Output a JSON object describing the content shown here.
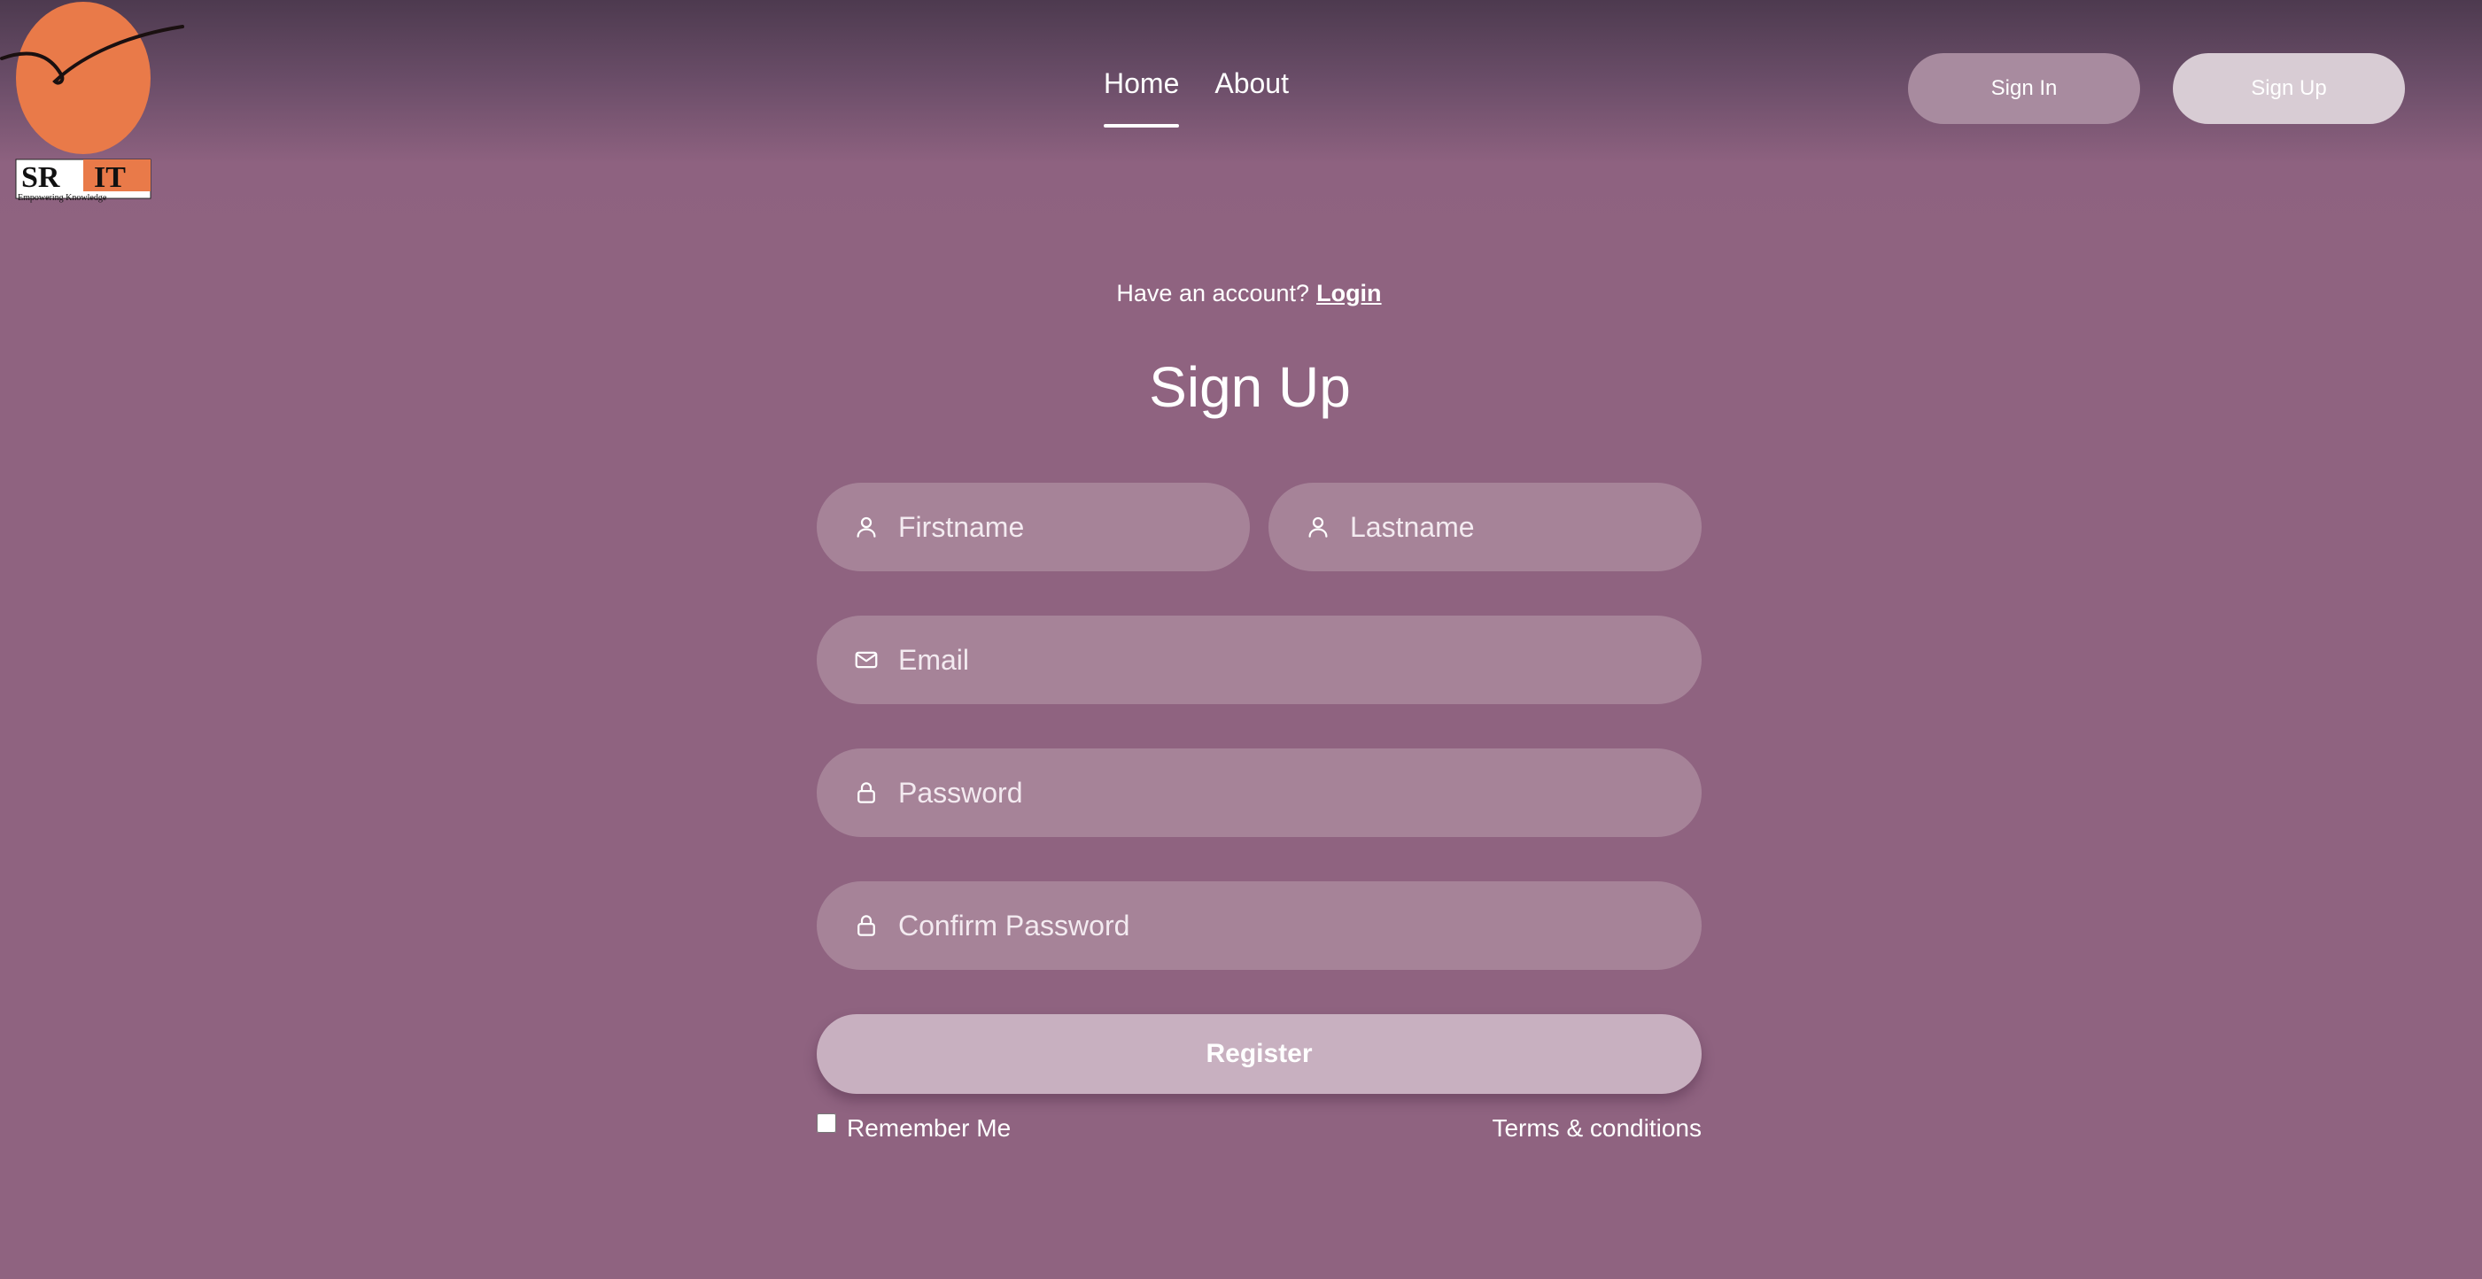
{
  "logo": {
    "text_left": "SR",
    "text_right": "IT",
    "tagline": "Empowering Knowledge",
    "circle_color": "#e97a49"
  },
  "nav": {
    "items": [
      {
        "label": "Home",
        "active": true
      },
      {
        "label": "About",
        "active": false
      }
    ]
  },
  "header_buttons": {
    "sign_in": "Sign In",
    "sign_up": "Sign Up"
  },
  "form": {
    "have_account_text": "Have an account?",
    "login_link": "Login",
    "title": "Sign Up",
    "fields": {
      "firstname": {
        "placeholder": "Firstname",
        "icon": "user-icon",
        "value": ""
      },
      "lastname": {
        "placeholder": "Lastname",
        "icon": "user-icon",
        "value": ""
      },
      "email": {
        "placeholder": "Email",
        "icon": "mail-icon",
        "value": ""
      },
      "password": {
        "placeholder": "Password",
        "icon": "lock-icon",
        "value": ""
      },
      "confirm_password": {
        "placeholder": "Confirm Password",
        "icon": "lock-icon",
        "value": ""
      }
    },
    "register_label": "Register",
    "remember_me_label": "Remember Me",
    "remember_me_checked": false,
    "terms_label": "Terms & conditions"
  },
  "colors": {
    "background": "#8f6380",
    "field_background": "#a68398",
    "register_button": "#c8b0c0",
    "sign_in_button": "#a88b9f",
    "sign_up_button": "#d8ccd4"
  }
}
